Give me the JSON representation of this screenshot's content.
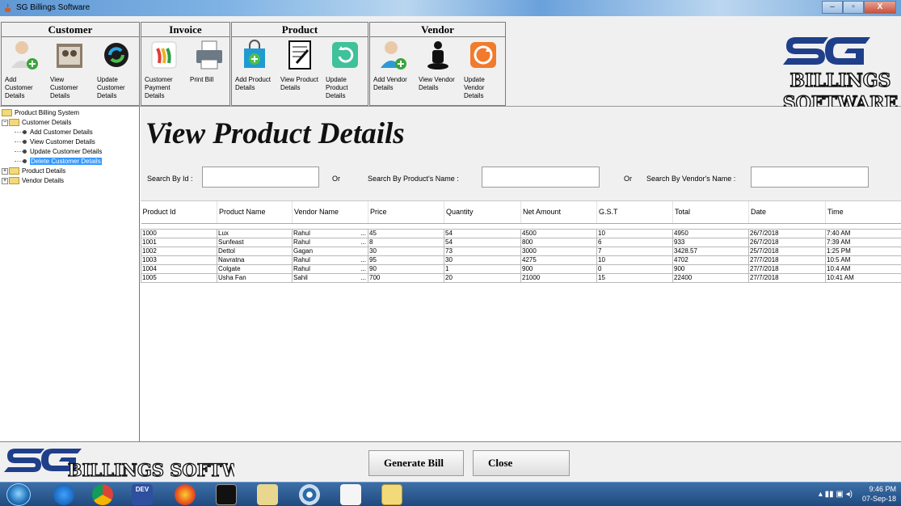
{
  "window": {
    "title": "SG Billings Software",
    "controls": [
      "–",
      "▫",
      "X"
    ]
  },
  "toolbar": {
    "groups": [
      {
        "heading": "Customer",
        "items": [
          {
            "label": "Add Customer Details",
            "icon": "add-customer-icon"
          },
          {
            "label": "View Customer Details",
            "icon": "view-customer-icon"
          },
          {
            "label": "Update Customer Details",
            "icon": "update-customer-icon"
          }
        ]
      },
      {
        "heading": "Invoice",
        "items": [
          {
            "label": "Customer Payment Details",
            "icon": "payment-icon"
          },
          {
            "label": "Print Bill",
            "icon": "printer-icon"
          }
        ]
      },
      {
        "heading": "Product",
        "items": [
          {
            "label": "Add Product Details",
            "icon": "add-product-icon"
          },
          {
            "label": "View Product Details",
            "icon": "view-product-icon"
          },
          {
            "label": "Update Product Details",
            "icon": "update-product-icon"
          }
        ]
      },
      {
        "heading": "Vendor",
        "items": [
          {
            "label": "Add Vendor Details",
            "icon": "add-vendor-icon"
          },
          {
            "label": "View Vendor Details",
            "icon": "view-vendor-icon"
          },
          {
            "label": "Update Vendor Details",
            "icon": "update-vendor-icon"
          }
        ]
      }
    ]
  },
  "logo": {
    "sg": "SG",
    "line1": "BILLINGS",
    "line2": "SOFTWARE",
    "bottom": "BILLINGS SOFTWARE"
  },
  "tree": {
    "root": "Product Billing System",
    "customer": "Customer Details",
    "customer_children": [
      "Add Customer Details",
      "View Customer Details",
      "Update Customer Details",
      "Delete Customer Details"
    ],
    "product": "Product Details",
    "vendor": "Vendor Details"
  },
  "main": {
    "title": "View Product Details",
    "search_id_label": "Search By Id :",
    "or1": "Or",
    "search_name_label": "Search By Product's Name :",
    "or2": "Or",
    "search_vendor_label": "Search By Vendor's Name :"
  },
  "table": {
    "columns": [
      "Product Id",
      "Product Name",
      "Vendor Name",
      "Price",
      "Quantity",
      "Net Amount",
      "G.S.T",
      "Total",
      "Date",
      "Time"
    ],
    "rows": [
      [
        "1000",
        "Lux",
        "Rahul",
        "45",
        "54",
        "4500",
        "10",
        "4950",
        "26/7/2018",
        "7:40 AM"
      ],
      [
        "1001",
        "Sunfeast",
        "Rahul",
        "8",
        "54",
        "800",
        "6",
        "933",
        "26/7/2018",
        "7:39 AM"
      ],
      [
        "1002",
        "Dettol",
        "Gagan",
        "30",
        "73",
        "3000",
        "7",
        "3428.57",
        "25/7/2018",
        "1:25 PM"
      ],
      [
        "1003",
        "Navratna",
        "Rahul",
        "95",
        "30",
        "4275",
        "10",
        "4702",
        "27/7/2018",
        "10:5 AM"
      ],
      [
        "1004",
        "Colgate",
        "Rahul",
        "90",
        "1",
        "900",
        "0",
        "900",
        "27/7/2018",
        "10:4 AM"
      ],
      [
        "1005",
        "Usha Fan",
        "Sahil",
        "700",
        "20",
        "21000",
        "15",
        "22400",
        "27/7/2018",
        "10:41 AM"
      ]
    ],
    "truncated_marker": "..."
  },
  "buttons": {
    "generate": "Generate Bill",
    "close": "Close"
  },
  "taskbar": {
    "time": "9:46 PM",
    "date": "07-Sep-18",
    "dev_label": "DEV"
  }
}
